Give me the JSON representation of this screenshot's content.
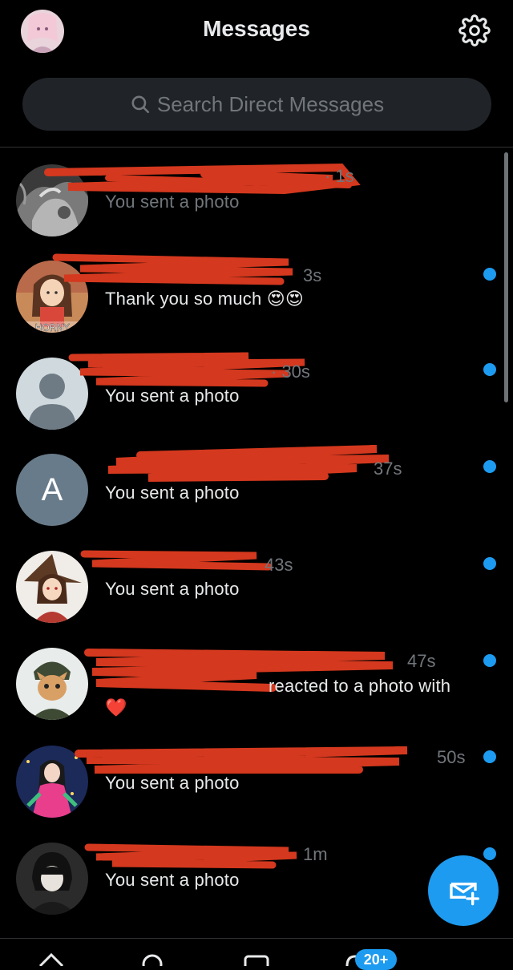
{
  "header": {
    "title": "Messages",
    "avatar_icon": "user-avatar-icon",
    "settings_icon": "gear-icon"
  },
  "search": {
    "placeholder": "Search Direct Messages",
    "icon": "search-icon"
  },
  "conversations": [
    {
      "time": "· 1s",
      "preview": "You sent a photo",
      "unread": false,
      "avatar": "photo-bw"
    },
    {
      "time": "3s",
      "preview": "Thank you so much 😍😍",
      "unread": true,
      "avatar": "anime-horny",
      "avatar_text": "HORNY"
    },
    {
      "time": "· 30s",
      "preview": "You sent a photo",
      "unread": true,
      "avatar": "default-person"
    },
    {
      "time": "37s",
      "preview": "You sent a photo",
      "unread": true,
      "avatar": "letter",
      "avatar_letter": "A"
    },
    {
      "time": "43s",
      "preview": "You sent a photo",
      "unread": true,
      "avatar": "anime-witch"
    },
    {
      "time": "47s",
      "preview": "reacted to a photo with",
      "preview_emoji": "❤️",
      "unread": true,
      "avatar": "cat-hood"
    },
    {
      "time": "50s",
      "preview": "You sent a photo",
      "unread": true,
      "avatar": "anime-colorful"
    },
    {
      "time": "1m",
      "preview": "You sent a photo",
      "unread": true,
      "avatar": "anime-dark"
    }
  ],
  "fab": {
    "icon": "new-message-icon"
  },
  "bottom_nav": {
    "badge": "20+",
    "icons": [
      "home-icon",
      "search-icon",
      "communities-icon",
      "notifications-icon"
    ]
  },
  "colors": {
    "background": "#000000",
    "accent": "#1d9bf0",
    "text_primary": "#e7e9ea",
    "text_secondary": "#71767b",
    "redaction": "#d4381e"
  }
}
